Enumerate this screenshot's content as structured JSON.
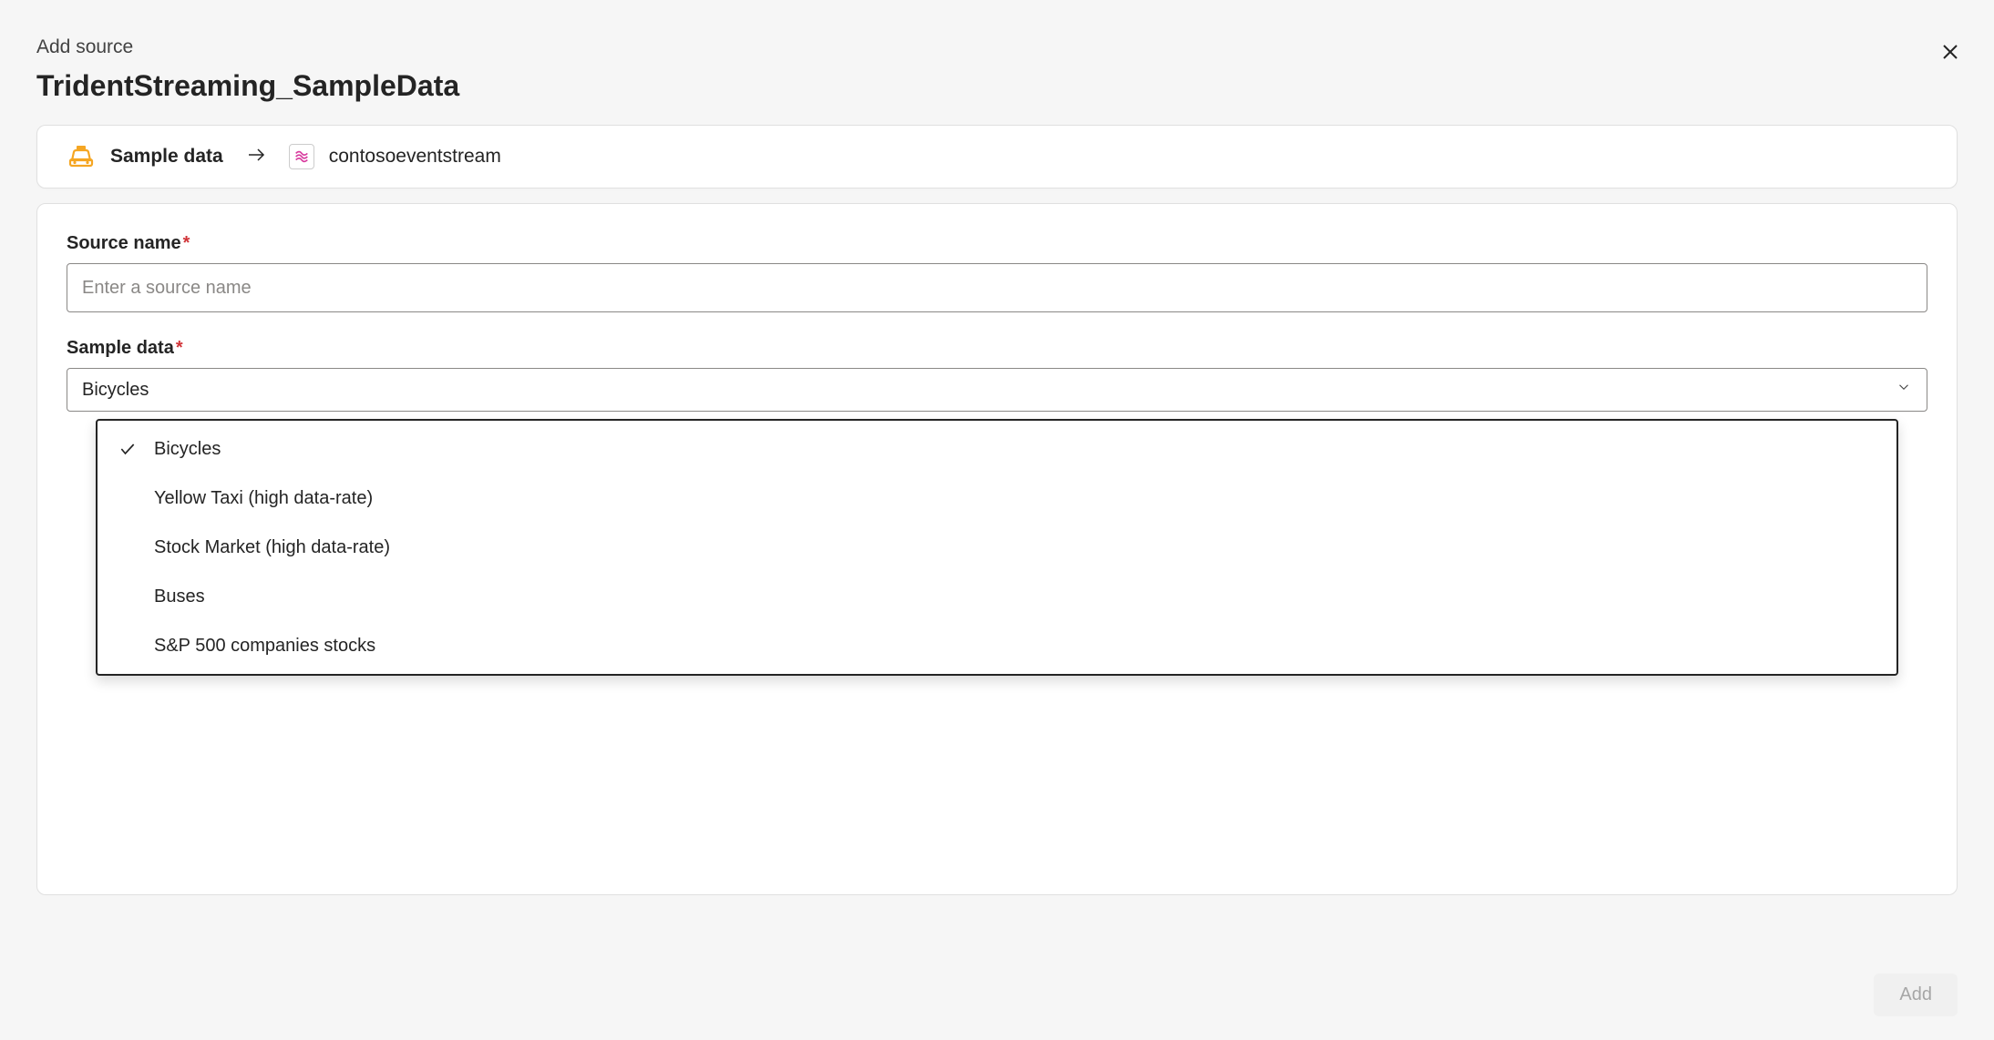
{
  "header": {
    "title": "Add source",
    "main_title": "TridentStreaming_SampleData"
  },
  "breadcrumb": {
    "source_label": "Sample data",
    "target_label": "contosoeventstream"
  },
  "form": {
    "source_name": {
      "label": "Source name",
      "placeholder": "Enter a source name",
      "value": ""
    },
    "sample_data": {
      "label": "Sample data",
      "selected": "Bicycles",
      "options": [
        "Bicycles",
        "Yellow Taxi (high data-rate)",
        "Stock Market (high data-rate)",
        "Buses",
        "S&P 500 companies stocks"
      ]
    }
  },
  "footer": {
    "add_label": "Add"
  }
}
